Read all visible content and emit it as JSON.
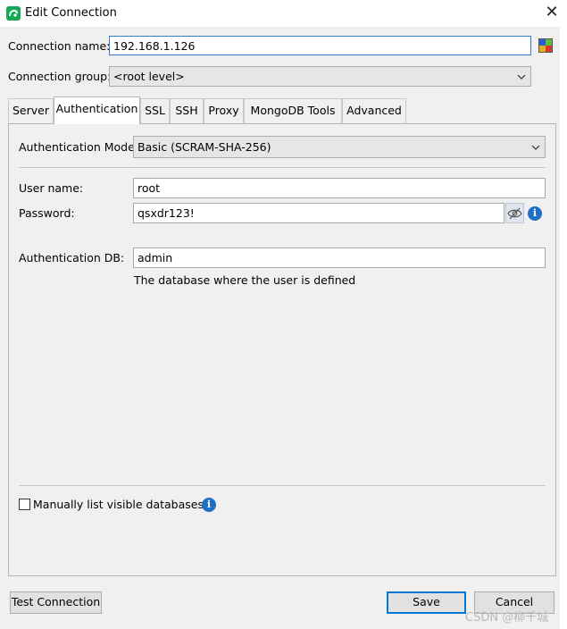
{
  "window": {
    "title": "Edit Connection",
    "close_glyph": "✕",
    "logo_icon": "mongodb-leaf-icon"
  },
  "connection": {
    "name_label": "Connection name:",
    "name_value": "192.168.1.126",
    "color_icon": "color-picker-icon",
    "group_label": "Connection group:",
    "group_value": "<root level>"
  },
  "tabs": [
    {
      "label": "Server",
      "active": false
    },
    {
      "label": "Authentication",
      "active": true
    },
    {
      "label": "SSL",
      "active": false
    },
    {
      "label": "SSH",
      "active": false
    },
    {
      "label": "Proxy",
      "active": false
    },
    {
      "label": "MongoDB Tools",
      "active": false
    },
    {
      "label": "Advanced",
      "active": false
    }
  ],
  "auth": {
    "mode_label": "Authentication Mode:",
    "mode_value": "Basic (SCRAM-SHA-256)",
    "username_label": "User name:",
    "username_value": "root",
    "password_label": "Password:",
    "password_value": "qsxdr123!",
    "password_toggle_icon": "eye-slash-icon",
    "db_label": "Authentication DB:",
    "db_value": "admin",
    "db_hint": "The database where the user is defined",
    "manual_list_label": "Manually list visible databases",
    "manual_list_checked": false,
    "info_glyph": "i"
  },
  "buttons": {
    "test_connection": "Test Connection",
    "save": "Save",
    "cancel": "Cancel"
  },
  "watermark": "CSDN @柳千城",
  "colors": {
    "accent": "#0078d7",
    "focus_border": "#2f7bd1",
    "info": "#1f6fc4",
    "logo": "#13aa52"
  }
}
